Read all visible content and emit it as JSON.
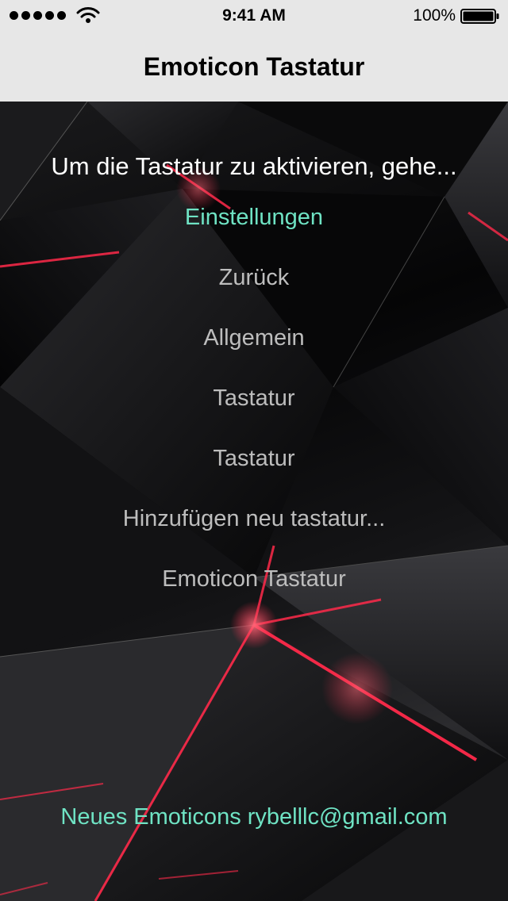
{
  "status_bar": {
    "time": "9:41 AM",
    "battery": "100%",
    "signal_icon": "signal-dots-icon",
    "wifi_icon": "wifi-icon",
    "battery_icon": "battery-icon"
  },
  "nav": {
    "title": "Emoticon Tastatur"
  },
  "instructions": {
    "heading": "Um die Tastatur zu aktivieren, gehe...",
    "settings_link": "Einstellungen",
    "steps": [
      "Zurück",
      "Allgemein",
      "Tastatur",
      "Tastatur",
      "Hinzufügen neu tastatur...",
      "Emoticon Tastatur"
    ]
  },
  "footer": {
    "contact": "Neues Emoticons rybelllc@gmail.com"
  },
  "colors": {
    "accent": "#6fe3c4",
    "bar_background": "#e7e7e7",
    "step_text": "#bdbdbd",
    "highlight_red": "#ff2a4a"
  }
}
